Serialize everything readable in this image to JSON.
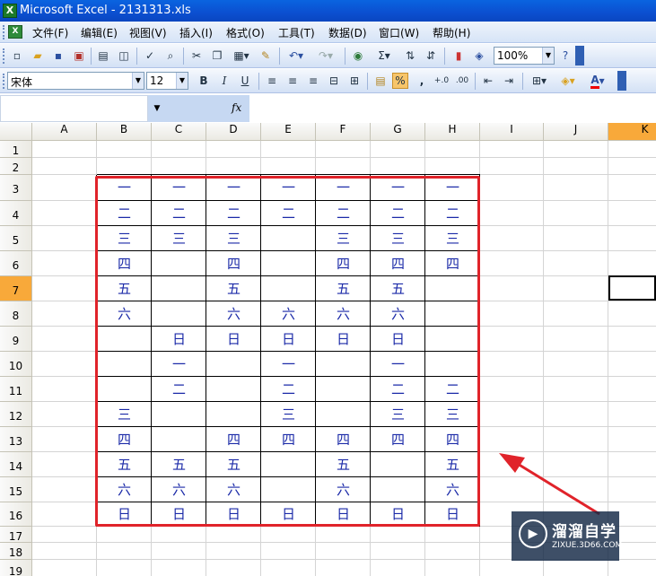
{
  "window": {
    "title": "Microsoft Excel - 2131313.xls",
    "app_icon": "excel-icon"
  },
  "menu": [
    "文件(F)",
    "编辑(E)",
    "视图(V)",
    "插入(I)",
    "格式(O)",
    "工具(T)",
    "数据(D)",
    "窗口(W)",
    "帮助(H)"
  ],
  "toolbar_standard": {
    "zoom": "100%"
  },
  "toolbar_format": {
    "font_name": "宋体",
    "font_size": "12",
    "bold": "B",
    "italic": "I",
    "underline": "U",
    "percent": "%",
    "comma": ",",
    "font_color_label": "A"
  },
  "formula_bar": {
    "name_box": "",
    "fx_label": "fx",
    "formula": ""
  },
  "columns": [
    "A",
    "B",
    "C",
    "D",
    "E",
    "F",
    "G",
    "H",
    "I",
    "J",
    "K"
  ],
  "selected_column": "K",
  "rows": [
    "1",
    "2",
    "3",
    "4",
    "5",
    "6",
    "7",
    "8",
    "9",
    "10",
    "11",
    "12",
    "13",
    "14",
    "15",
    "16",
    "17",
    "18",
    "19"
  ],
  "selected_row": "7",
  "table": [
    [
      "一",
      "一",
      "一",
      "一",
      "一",
      "一",
      "一"
    ],
    [
      "二",
      "二",
      "二",
      "二",
      "二",
      "二",
      "二"
    ],
    [
      "三",
      "三",
      "三",
      "",
      "三",
      "三",
      "三"
    ],
    [
      "四",
      "",
      "四",
      "",
      "四",
      "四",
      "四"
    ],
    [
      "五",
      "",
      "五",
      "",
      "五",
      "五",
      ""
    ],
    [
      "六",
      "",
      "六",
      "六",
      "六",
      "六",
      ""
    ],
    [
      "",
      "日",
      "日",
      "日",
      "日",
      "日",
      ""
    ],
    [
      "",
      "一",
      "",
      "一",
      "",
      "一",
      ""
    ],
    [
      "",
      "二",
      "",
      "二",
      "",
      "二",
      "二"
    ],
    [
      "三",
      "",
      "",
      "三",
      "",
      "三",
      "三"
    ],
    [
      "四",
      "",
      "四",
      "四",
      "四",
      "四",
      "四"
    ],
    [
      "五",
      "五",
      "五",
      "",
      "五",
      "",
      "五"
    ],
    [
      "六",
      "六",
      "六",
      "",
      "六",
      "",
      "六"
    ],
    [
      "日",
      "日",
      "日",
      "日",
      "日",
      "日",
      "日"
    ]
  ],
  "watermark": {
    "name": "溜溜自学",
    "url": "ZIXUE.3D66.COM"
  },
  "colors": {
    "highlight": "#e0232a",
    "cell_text": "#1b2aa8",
    "header_selected": "#f8a93a"
  }
}
